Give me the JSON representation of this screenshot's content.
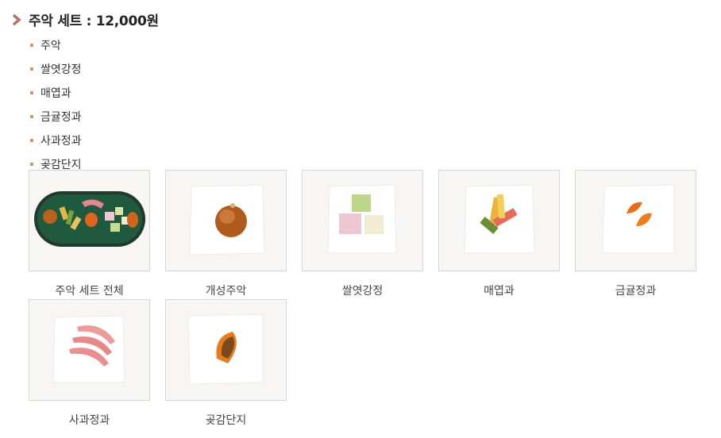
{
  "heading": "주악 세트 : 12,000원",
  "items": [
    "주악",
    "쌀엿강정",
    "매엽과",
    "금귤정과",
    "사과정과",
    "곶감단지"
  ],
  "gallery": [
    {
      "caption": "주악 세트 전체",
      "icon": "full-set-tray-image"
    },
    {
      "caption": "개성주악",
      "icon": "gaeseong-juak-image"
    },
    {
      "caption": "쌀엿강정",
      "icon": "rice-gangjeong-image"
    },
    {
      "caption": "매엽과",
      "icon": "maeyeopgwa-image"
    },
    {
      "caption": "금귤정과",
      "icon": "kumquat-jeonggwa-image"
    },
    {
      "caption": "사과정과",
      "icon": "apple-jeonggwa-image"
    },
    {
      "caption": "곶감단지",
      "icon": "gotgam-danji-image"
    }
  ],
  "colors": {
    "accent": "#b07868",
    "bullet": "#c69a7a",
    "border": "#d6d6d6"
  }
}
